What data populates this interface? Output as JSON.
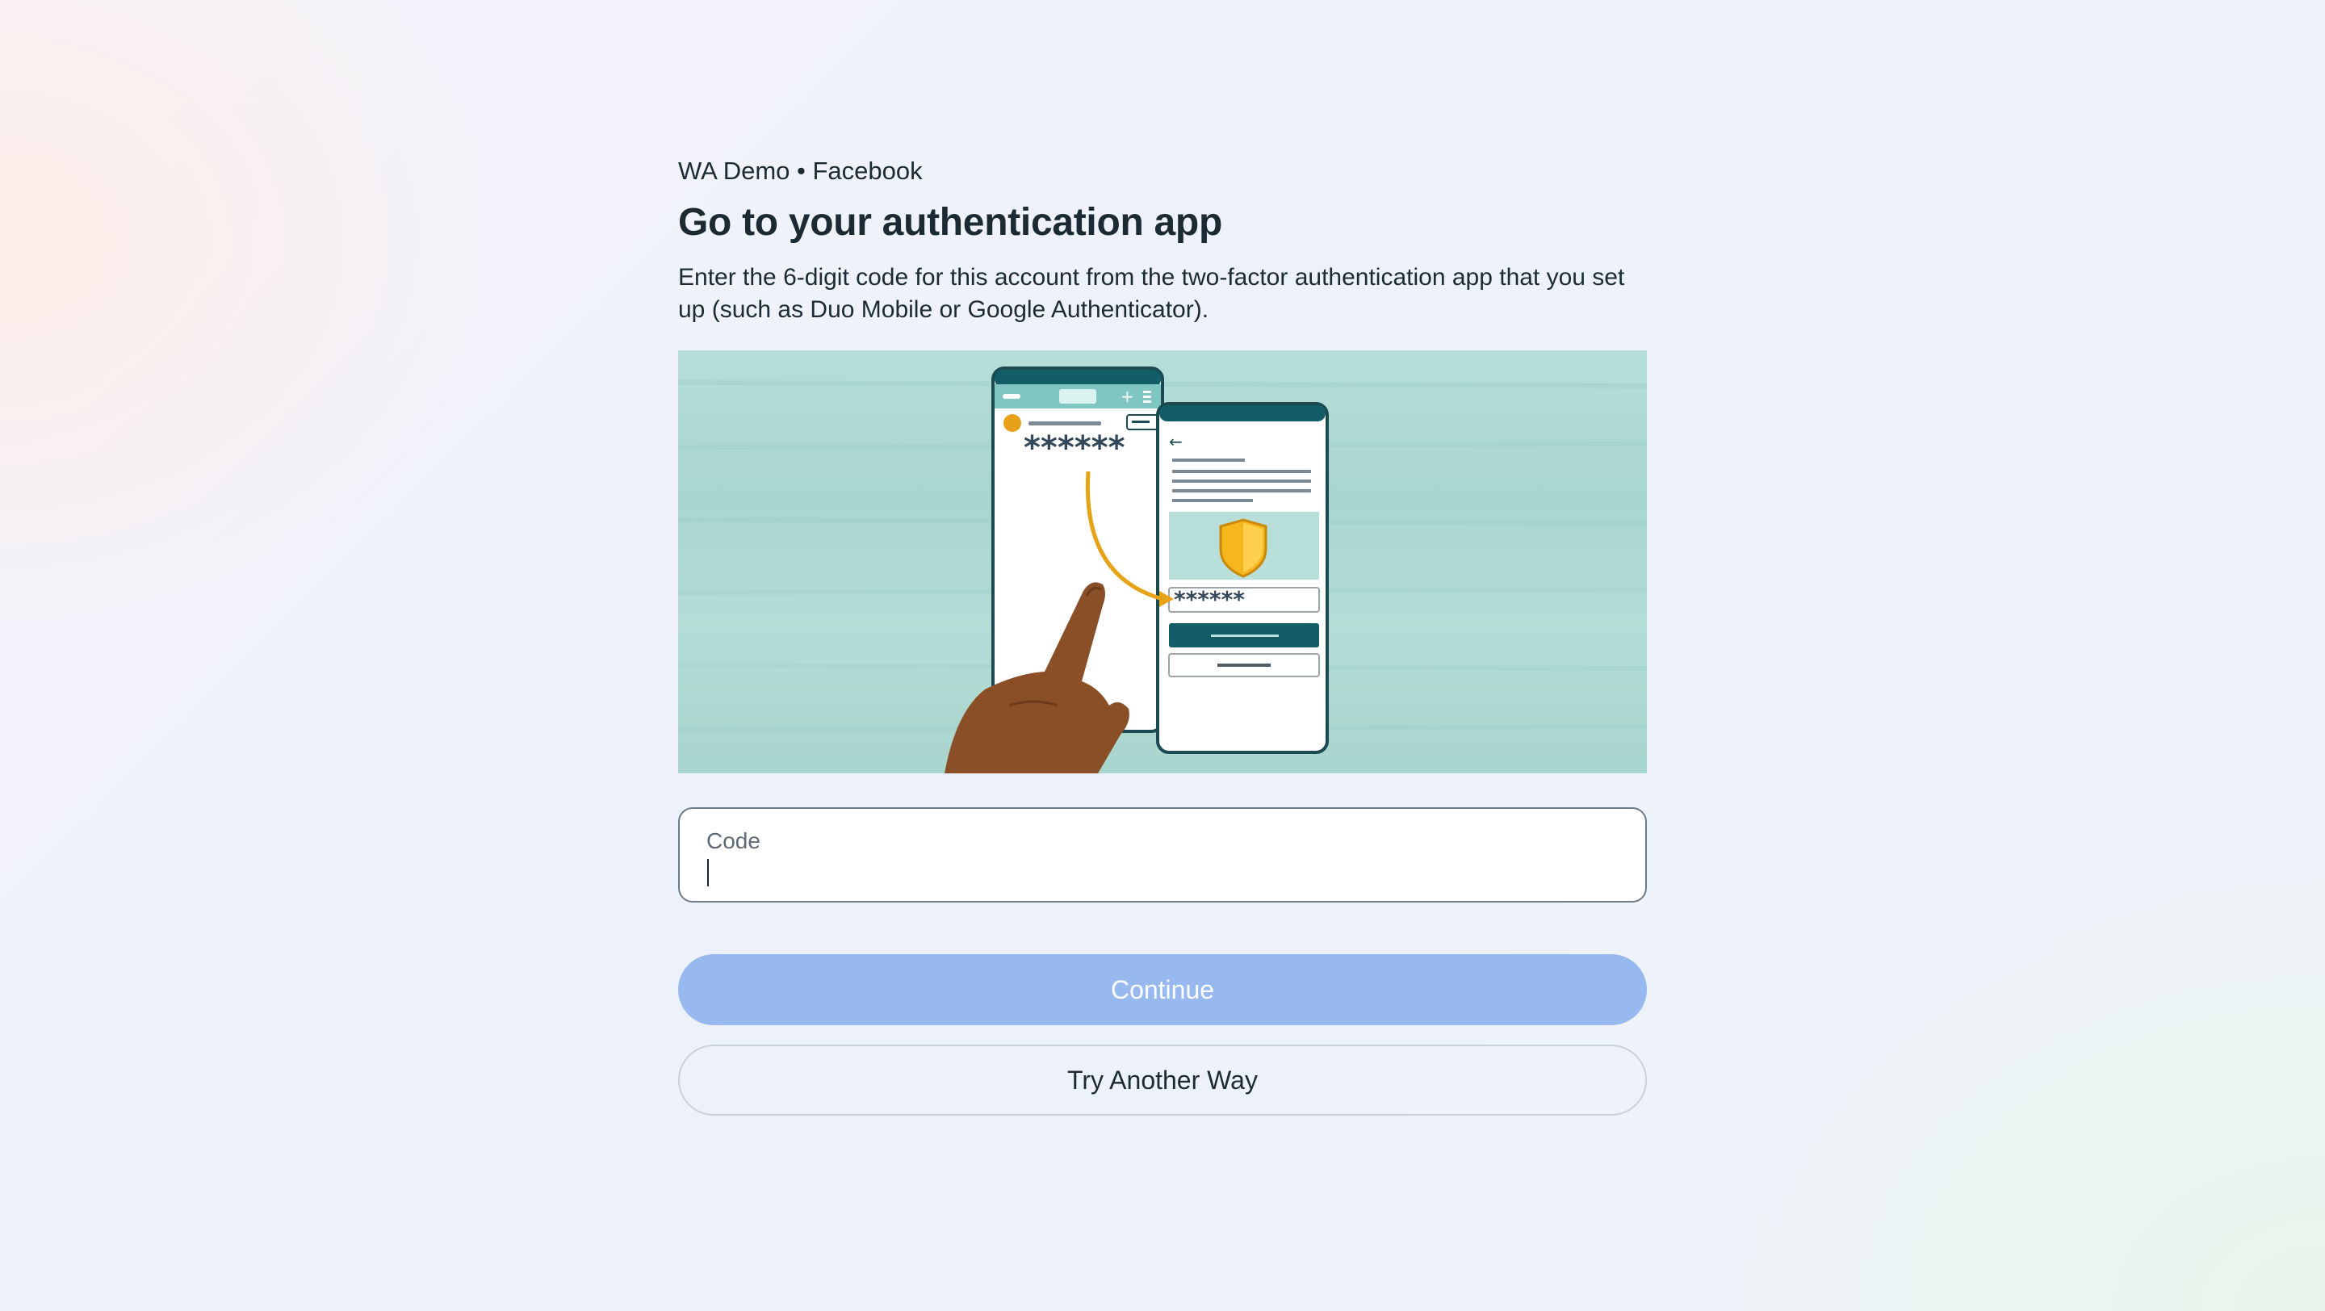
{
  "header": {
    "account_line": "WA Demo • Facebook",
    "title": "Go to your authentication app",
    "description": "Enter the 6-digit code for this account from the two-factor authentication app that you set up (such as Duo Mobile or Google Authenticator)."
  },
  "illustration": {
    "icon": "phone-authentication-illustration",
    "code_mask_left": "******",
    "code_mask_right": "******"
  },
  "code_field": {
    "label": "Code",
    "value": "",
    "placeholder": ""
  },
  "actions": {
    "continue_label": "Continue",
    "try_another_label": "Try Another Way"
  },
  "colors": {
    "primary_disabled": "#98b9ef",
    "illustration_bg": "#b0dad3",
    "phone_header": "#135d66",
    "shield": "#f5b71c",
    "arrow": "#e6a315"
  }
}
